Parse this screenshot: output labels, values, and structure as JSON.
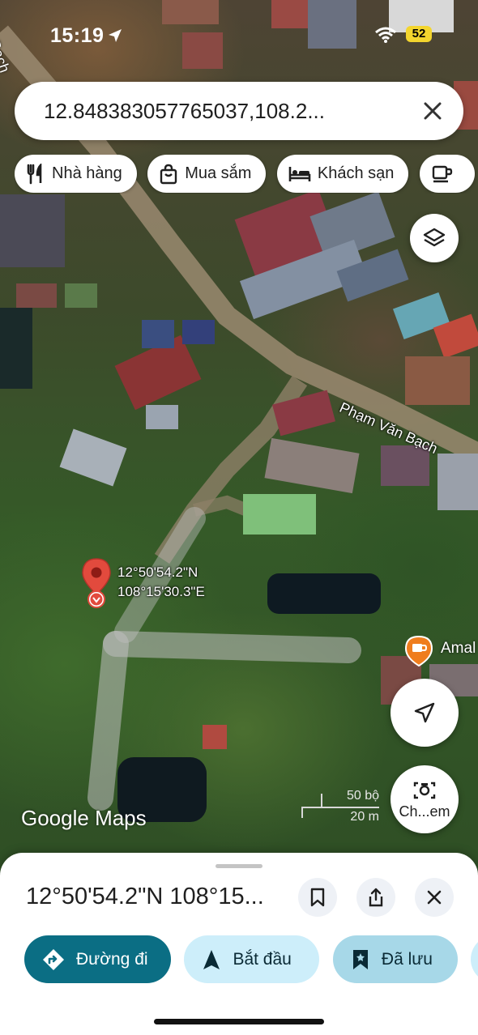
{
  "status_bar": {
    "time": "15:19",
    "battery": "52"
  },
  "search": {
    "query": "12.848383057765037,108.2..."
  },
  "chips": [
    {
      "label": "Nhà hàng",
      "icon": "restaurant-icon"
    },
    {
      "label": "Mua sắm",
      "icon": "shopping-bag-icon"
    },
    {
      "label": "Khách sạn",
      "icon": "hotel-bed-icon"
    },
    {
      "label": "",
      "icon": "coffee-cup-icon"
    }
  ],
  "map": {
    "street_label": "Phạm Văn Bạch",
    "edge_street_label": "Bạch",
    "pin_lat": "12°50'54.2\"N",
    "pin_lng": "108°15'30.3\"E",
    "poi_label": "Amal",
    "logo": "Google Maps",
    "scale_ft": "50 bộ",
    "scale_m": "20 m",
    "streetview_label": "Ch...em"
  },
  "place": {
    "title": "12°50'54.2\"N 108°15...",
    "actions": [
      {
        "label": "Đường đi",
        "icon": "directions-icon"
      },
      {
        "label": "Bắt đầu",
        "icon": "navigation-arrow-icon"
      },
      {
        "label": "Đã lưu",
        "icon": "bookmark-icon"
      }
    ]
  },
  "colors": {
    "pin_red": "#e24a3d",
    "primary_teal": "#0b6e84",
    "light_teal": "#cdeefa",
    "saved_teal": "#a7d8e8",
    "poi_orange": "#ef7d1e"
  }
}
